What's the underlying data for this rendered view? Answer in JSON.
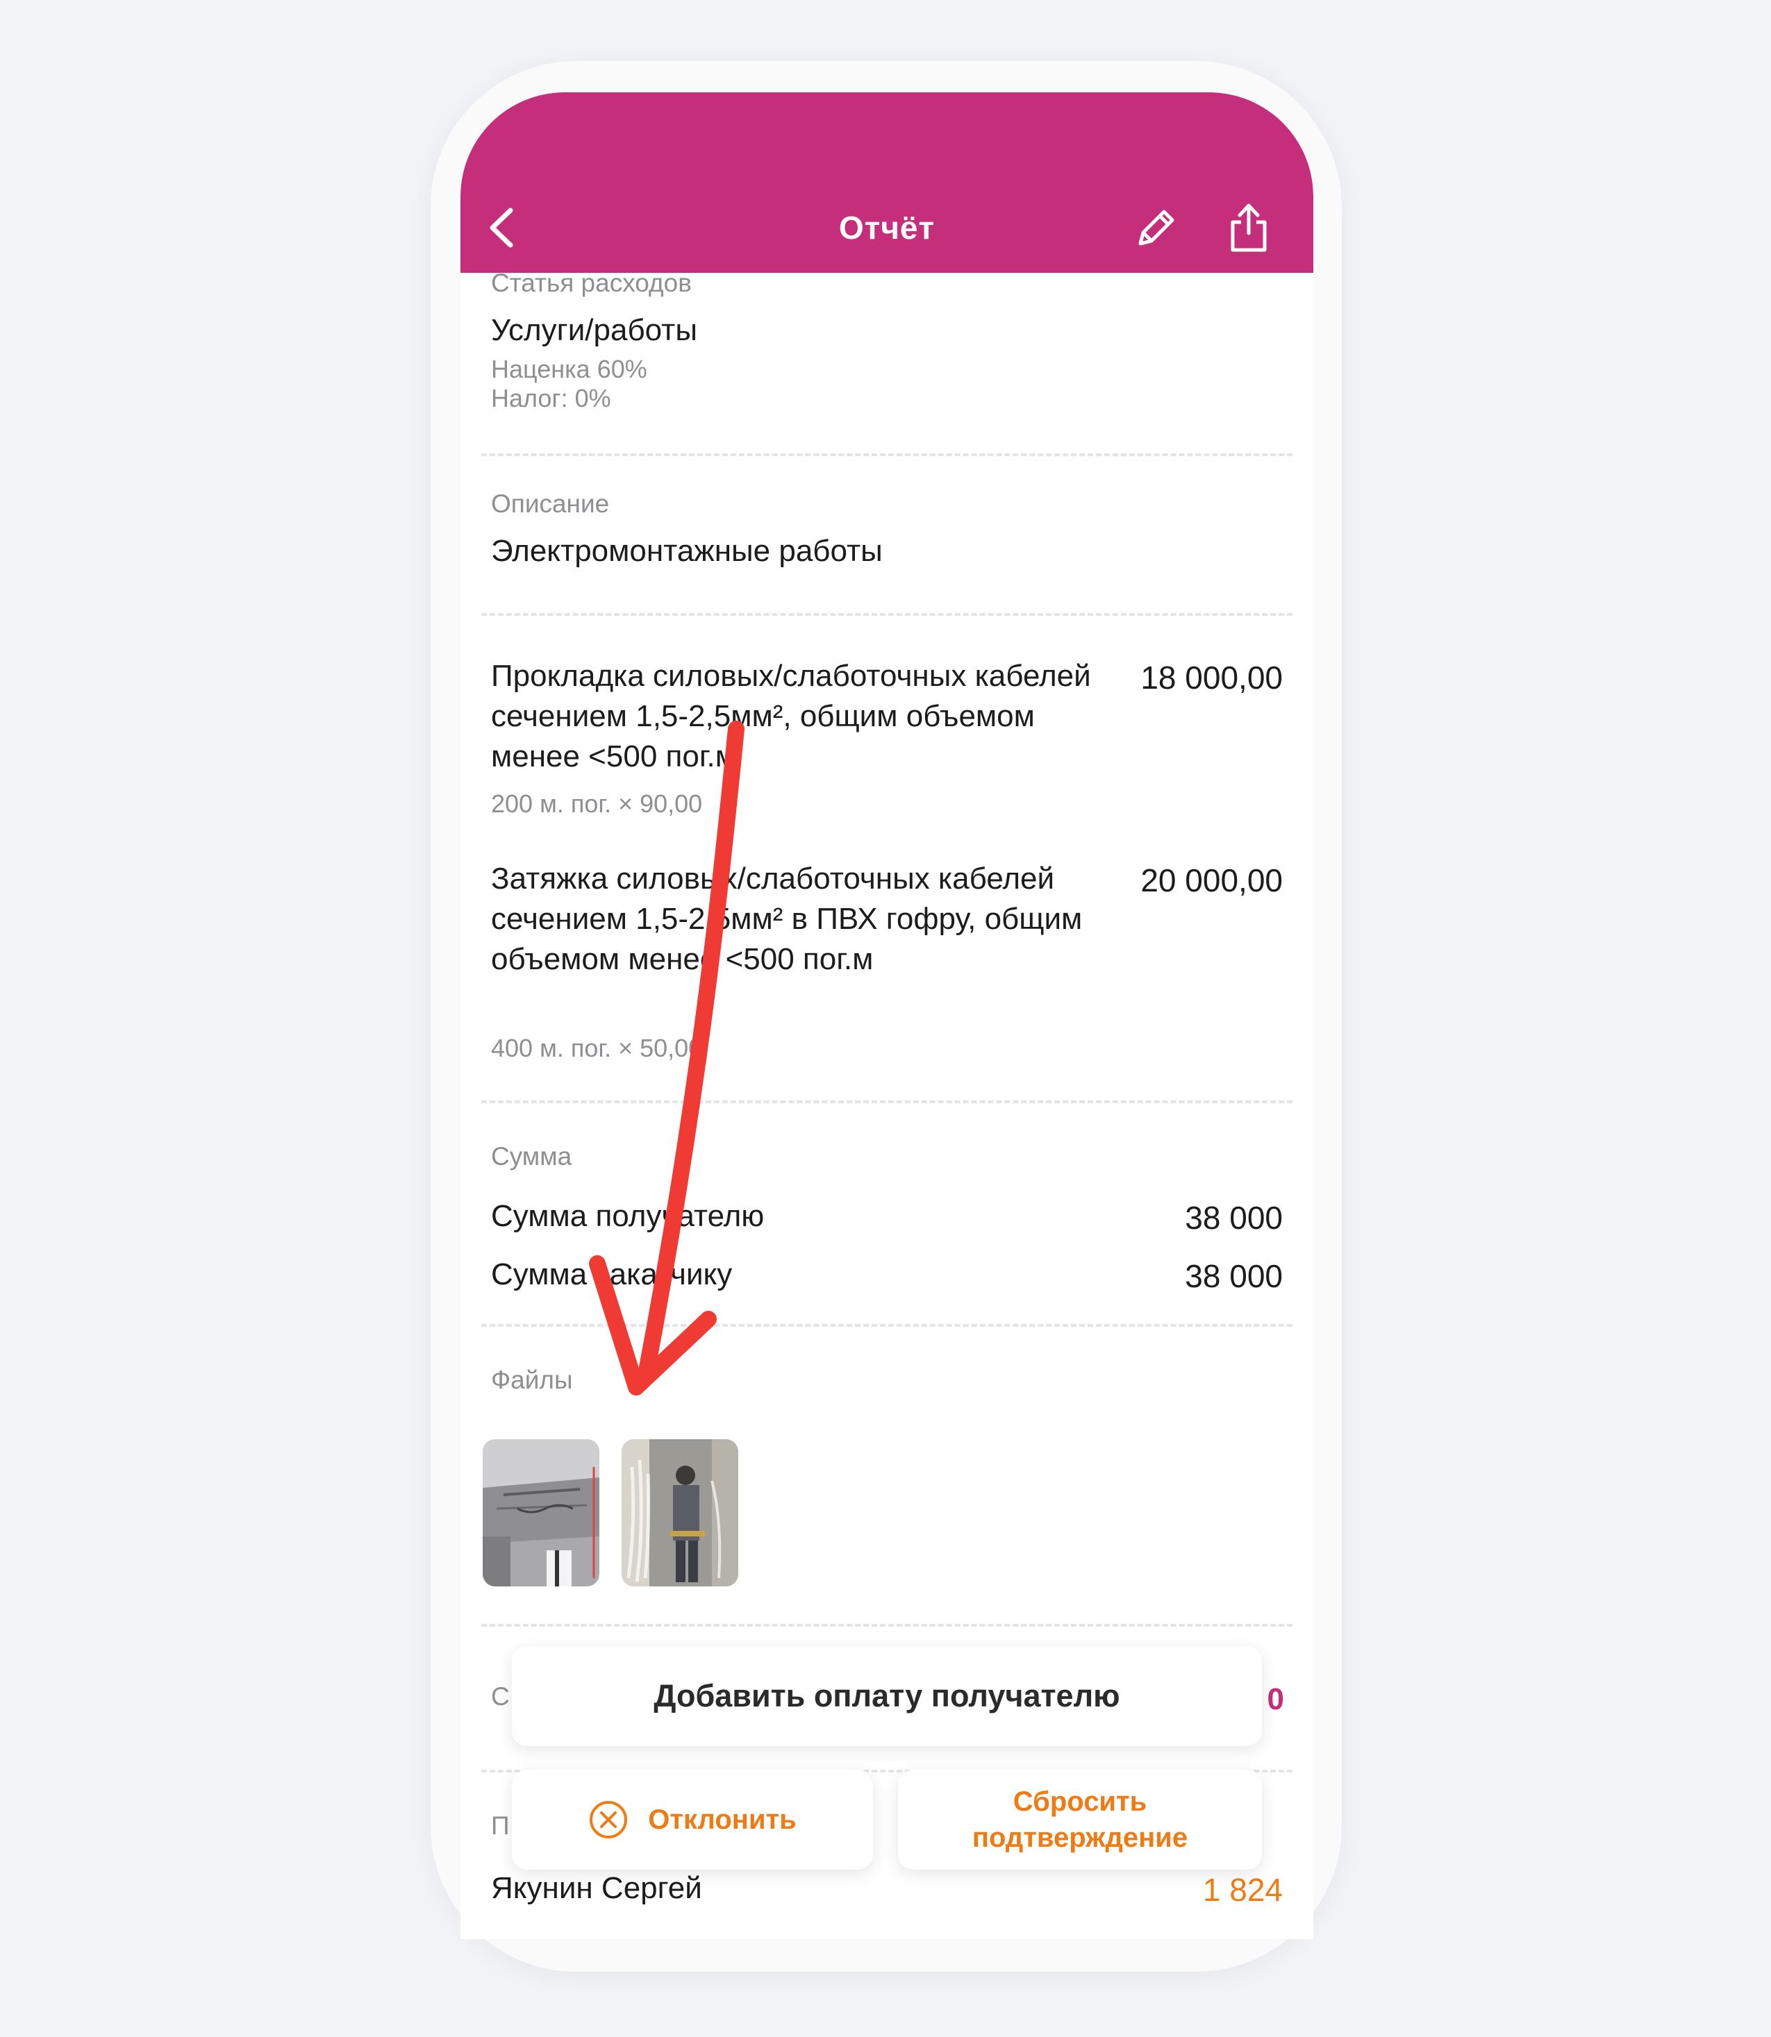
{
  "header": {
    "title": "Отчёт"
  },
  "expense": {
    "label": "Статья расходов",
    "value": "Услуги/работы",
    "markup": "Наценка 60%",
    "tax": "Налог: 0%"
  },
  "description": {
    "label": "Описание",
    "value": "Электромонтажные работы"
  },
  "items": [
    {
      "name": "Прокладка силовых/слаботочных кабелей сечением 1,5-2,5мм², общим объемом менее <500 пог.м",
      "qty": "200 м. пог. × 90,00",
      "amount": "18 000,00"
    },
    {
      "name": "Затяжка силовых/слаботочных кабелей сечением 1,5-2,5мм² в ПВХ гофру, общим объемом менее <500 пог.м",
      "qty": "400 м. пог. × 50,00",
      "amount": "20 000,00"
    }
  ],
  "sum": {
    "label": "Сумма",
    "recipient_label": "Сумма получателю",
    "recipient_value": "38 000",
    "customer_label": "Сумма заказчику",
    "customer_value": "38 000"
  },
  "files": {
    "label": "Файлы"
  },
  "partial_row": {
    "label_left": "С",
    "value_right": "0"
  },
  "payer_row": {
    "label_left": "П",
    "name": "Якунин Сергей",
    "value": "1 824"
  },
  "buttons": {
    "add_payment": "Добавить оплату получателю",
    "reject": "Отклонить",
    "reset_line1": "Сбросить",
    "reset_line2": "подтверждение"
  },
  "colors": {
    "header_bg": "#c42e7a",
    "accent_orange": "#ef7b14",
    "annotation_red": "#ef3b34"
  }
}
